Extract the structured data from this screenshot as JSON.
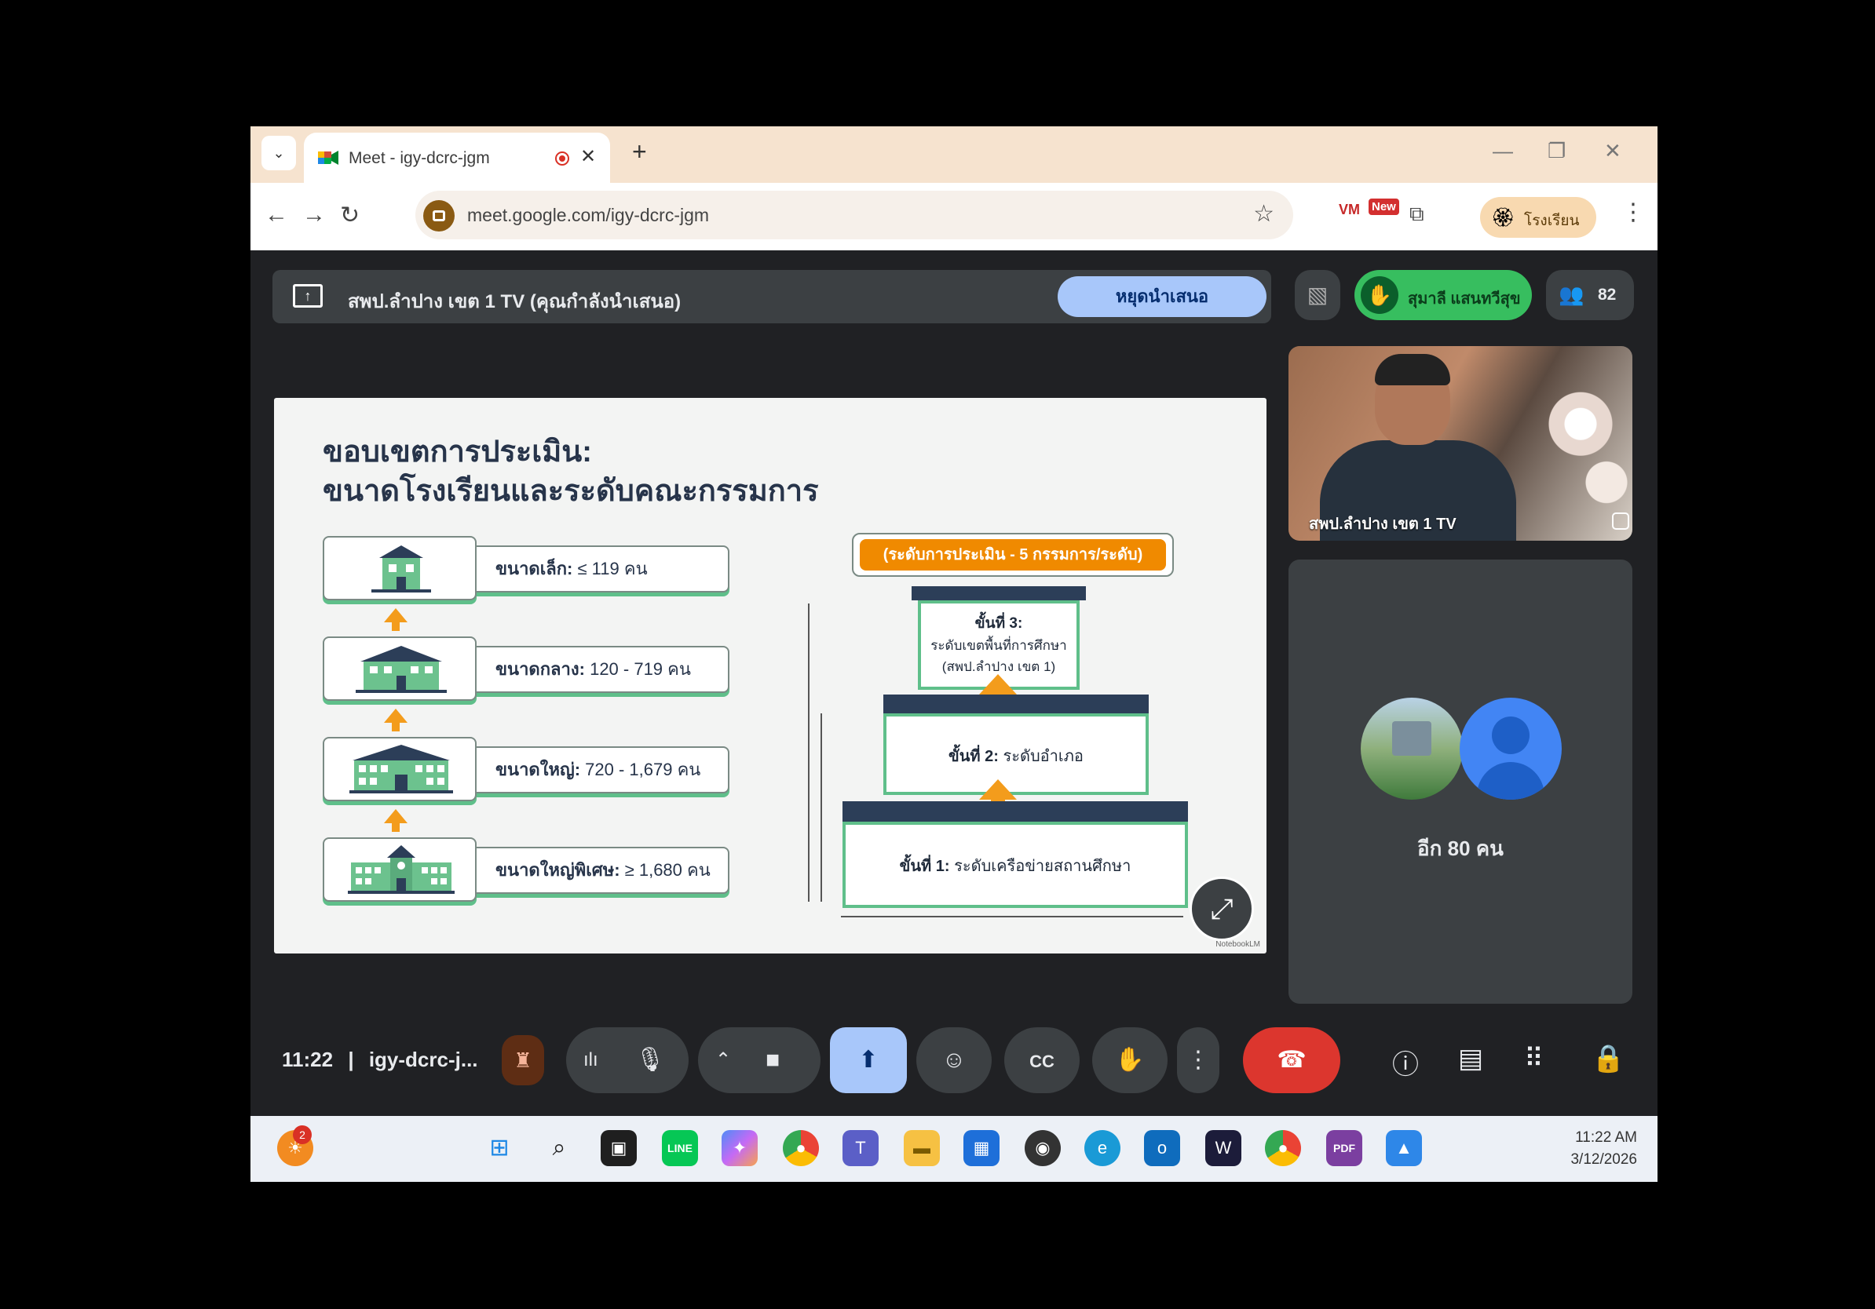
{
  "browser": {
    "tab_title": "Meet - igy-dcrc-jgm",
    "url": "meet.google.com/igy-dcrc-jgm",
    "profile_label": "โรงเรียน",
    "ext_vm": "VM",
    "ext_new": "New"
  },
  "meet": {
    "presenting_text": "สพป.ลำปาง เขต 1 TV (คุณกำลังนำเสนอ)",
    "stop_presenting_label": "หยุดนำเสนอ",
    "raised_hand_name": "สุมาลี แสนทวีสุข",
    "participant_count": "82",
    "video_tile_name": "สพป.ลำปาง เขต 1 TV",
    "others_label": "อีก 80 คน",
    "time": "11:22",
    "separator": "|",
    "meeting_code": "igy-dcrc-j..."
  },
  "slide": {
    "title_line1": "ขอบเขตการประเมิน:",
    "title_line2": "ขนาดโรงเรียนและระดับคณะกรรมการ",
    "sizes": [
      {
        "label": "ขนาดเล็ก:",
        "value": "≤ 119 คน"
      },
      {
        "label": "ขนาดกลาง:",
        "value": "120 - 719 คน"
      },
      {
        "label": "ขนาดใหญ่:",
        "value": "720 - 1,679 คน"
      },
      {
        "label": "ขนาดใหญ่พิเศษ:",
        "value": "≥ 1,680 คน"
      }
    ],
    "banner": "(ระดับการประเมิน - 5 กรรมการ/ระดับ)",
    "step3_title": "ขั้นที่ 3:",
    "step3_line1": "ระดับเขตพื้นที่การศึกษา",
    "step3_line2": "(สพป.ลำปาง เขต 1)",
    "step2_label": "ขั้นที่ 2:",
    "step2_value": "ระดับอำเภอ",
    "step1_label": "ขั้นที่ 1:",
    "step1_value": "ระดับเครือข่ายสถานศึกษา",
    "watermark": "NotebookLM"
  },
  "taskbar": {
    "notification_badge": "2",
    "clock_time": "11:22 AM",
    "clock_date": "3/12/2026"
  },
  "colors": {
    "accent_blue": "#a8c7fa",
    "end_call_red": "#dc362e",
    "hand_green": "#37be5f",
    "slide_orange": "#f08a00",
    "slide_green": "#5fbf8a"
  }
}
